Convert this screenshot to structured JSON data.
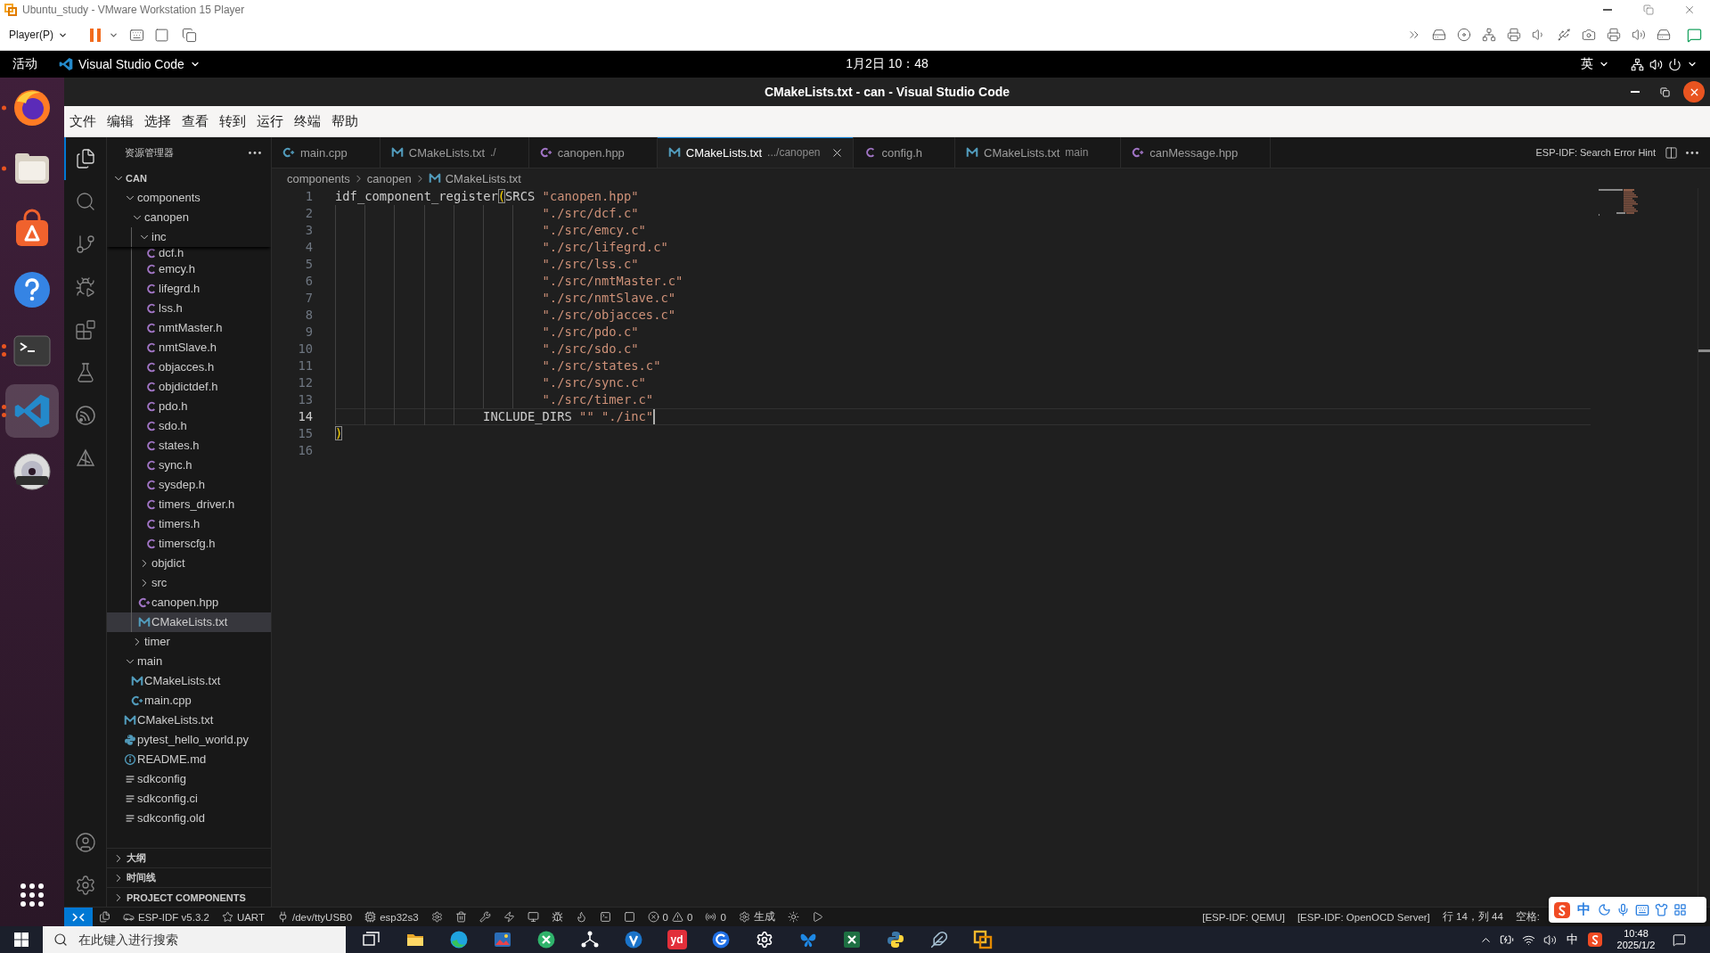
{
  "vm_window": {
    "title": "Ubuntu_study - VMware Workstation 15 Player",
    "player_menu": "Player(P)"
  },
  "top_bar": {
    "activities": "活动",
    "app_menu": "Visual Studio Code",
    "clock": "1月2日 10：48",
    "input_method": "英"
  },
  "dock": [
    {
      "kind": "browser",
      "running": true,
      "multiple_windows": false,
      "selected": false
    },
    {
      "kind": "files",
      "running": true,
      "multiple_windows": false,
      "selected": false
    },
    {
      "kind": "app-store",
      "running": false,
      "multiple_windows": false,
      "selected": false
    },
    {
      "kind": "help",
      "running": false,
      "multiple_windows": false,
      "selected": false
    },
    {
      "kind": "terminal",
      "running": true,
      "multiple_windows": true,
      "selected": false
    },
    {
      "kind": "code-editor",
      "running": true,
      "multiple_windows": true,
      "selected": true
    },
    {
      "kind": "dvd",
      "running": false,
      "multiple_windows": false,
      "selected": false
    }
  ],
  "vscode": {
    "title": "CMakeLists.txt - can - Visual Studio Code",
    "menu": [
      "文件",
      "编辑",
      "选择",
      "查看",
      "转到",
      "运行",
      "终端",
      "帮助"
    ],
    "activity_bar": [
      {
        "kind": "explorer",
        "selected": true
      },
      {
        "kind": "search",
        "selected": false
      },
      {
        "kind": "source-control",
        "selected": false
      },
      {
        "kind": "run-debug",
        "selected": false
      },
      {
        "kind": "extensions",
        "selected": false
      },
      {
        "kind": "testing",
        "selected": false
      },
      {
        "kind": "esp-idf",
        "selected": false
      },
      {
        "kind": "idf-tools",
        "selected": false
      }
    ],
    "explorer": {
      "title": "资源管理器",
      "workspace": {
        "name": "CAN",
        "expanded": true
      },
      "tree": [
        {
          "label": "components",
          "kind": "folder",
          "expanded": true,
          "selected": false,
          "children": [
            {
              "label": "canopen",
              "kind": "folder",
              "expanded": true,
              "selected": false,
              "children": [
                {
                  "label": "inc",
                  "kind": "folder",
                  "expanded": true,
                  "selected": false,
                  "children": [
                    {
                      "label": "dcf.h",
                      "kind": "c-header",
                      "selected": false
                    },
                    {
                      "label": "emcy.h",
                      "kind": "c-header",
                      "selected": false
                    },
                    {
                      "label": "lifegrd.h",
                      "kind": "c-header",
                      "selected": false
                    },
                    {
                      "label": "lss.h",
                      "kind": "c-header",
                      "selected": false
                    },
                    {
                      "label": "nmtMaster.h",
                      "kind": "c-header",
                      "selected": false
                    },
                    {
                      "label": "nmtSlave.h",
                      "kind": "c-header",
                      "selected": false
                    },
                    {
                      "label": "objacces.h",
                      "kind": "c-header",
                      "selected": false
                    },
                    {
                      "label": "objdictdef.h",
                      "kind": "c-header",
                      "selected": false
                    },
                    {
                      "label": "pdo.h",
                      "kind": "c-header",
                      "selected": false
                    },
                    {
                      "label": "sdo.h",
                      "kind": "c-header",
                      "selected": false
                    },
                    {
                      "label": "states.h",
                      "kind": "c-header",
                      "selected": false
                    },
                    {
                      "label": "sync.h",
                      "kind": "c-header",
                      "selected": false
                    },
                    {
                      "label": "sysdep.h",
                      "kind": "c-header",
                      "selected": false
                    },
                    {
                      "label": "timers_driver.h",
                      "kind": "c-header",
                      "selected": false
                    },
                    {
                      "label": "timers.h",
                      "kind": "c-header",
                      "selected": false
                    },
                    {
                      "label": "timerscfg.h",
                      "kind": "c-header",
                      "selected": false
                    }
                  ]
                },
                {
                  "label": "objdict",
                  "kind": "folder",
                  "expanded": false,
                  "selected": false
                },
                {
                  "label": "src",
                  "kind": "folder",
                  "expanded": false,
                  "selected": false
                },
                {
                  "label": "canopen.hpp",
                  "kind": "cpp-header",
                  "selected": false
                },
                {
                  "label": "CMakeLists.txt",
                  "kind": "cmake",
                  "selected": true
                }
              ]
            },
            {
              "label": "timer",
              "kind": "folder",
              "expanded": false,
              "selected": false
            }
          ]
        },
        {
          "label": "main",
          "kind": "folder",
          "expanded": true,
          "selected": false,
          "children": [
            {
              "label": "CMakeLists.txt",
              "kind": "cmake",
              "selected": false
            },
            {
              "label": "main.cpp",
              "kind": "cpp-source",
              "selected": false
            }
          ]
        },
        {
          "label": "CMakeLists.txt",
          "kind": "cmake",
          "selected": false
        },
        {
          "label": "pytest_hello_world.py",
          "kind": "python",
          "selected": false
        },
        {
          "label": "README.md",
          "kind": "info",
          "selected": false
        },
        {
          "label": "sdkconfig",
          "kind": "config",
          "selected": false
        },
        {
          "label": "sdkconfig.ci",
          "kind": "config",
          "selected": false
        },
        {
          "label": "sdkconfig.old",
          "kind": "config",
          "selected": false
        }
      ],
      "sections": [
        {
          "label": "大纲",
          "expanded": false
        },
        {
          "label": "时间线",
          "expanded": false
        },
        {
          "label": "PROJECT COMPONENTS",
          "expanded": false
        }
      ]
    },
    "tabs": [
      {
        "label": "main.cpp",
        "kind": "cpp-source",
        "selected": false
      },
      {
        "label": "CMakeLists.txt",
        "description": "./",
        "kind": "cmake",
        "selected": false
      },
      {
        "label": "canopen.hpp",
        "kind": "cpp-header",
        "selected": false
      },
      {
        "label": "CMakeLists.txt",
        "description": ".../canopen",
        "kind": "cmake",
        "selected": true
      },
      {
        "label": "config.h",
        "kind": "c-header",
        "selected": false
      },
      {
        "label": "CMakeLists.txt",
        "description": "main",
        "kind": "cmake",
        "selected": false
      },
      {
        "label": "canMessage.hpp",
        "kind": "cpp-header",
        "selected": false
      }
    ],
    "editor_actions": {
      "hint": "ESP-IDF: Search Error Hint"
    },
    "breadcrumb": {
      "path": [
        "components",
        "canopen"
      ],
      "file": {
        "label": "CMakeLists.txt",
        "kind": "cmake"
      }
    },
    "code": [
      {
        "number": "1",
        "current": false,
        "tokens": [
          {
            "kind": "plain",
            "text": "idf_component_register"
          },
          {
            "kind": "bracket",
            "text": "("
          },
          {
            "kind": "plain",
            "text": "SRCS "
          },
          {
            "kind": "string",
            "text": "\"canopen.hpp\""
          }
        ]
      },
      {
        "number": "2",
        "current": false,
        "tokens": [
          {
            "kind": "string",
            "text": "                            \"./src/dcf.c\""
          }
        ]
      },
      {
        "number": "3",
        "current": false,
        "tokens": [
          {
            "kind": "string",
            "text": "                            \"./src/emcy.c\""
          }
        ]
      },
      {
        "number": "4",
        "current": false,
        "tokens": [
          {
            "kind": "string",
            "text": "                            \"./src/lifegrd.c\""
          }
        ]
      },
      {
        "number": "5",
        "current": false,
        "tokens": [
          {
            "kind": "string",
            "text": "                            \"./src/lss.c\""
          }
        ]
      },
      {
        "number": "6",
        "current": false,
        "tokens": [
          {
            "kind": "string",
            "text": "                            \"./src/nmtMaster.c\""
          }
        ]
      },
      {
        "number": "7",
        "current": false,
        "tokens": [
          {
            "kind": "string",
            "text": "                            \"./src/nmtSlave.c\""
          }
        ]
      },
      {
        "number": "8",
        "current": false,
        "tokens": [
          {
            "kind": "string",
            "text": "                            \"./src/objacces.c\""
          }
        ]
      },
      {
        "number": "9",
        "current": false,
        "tokens": [
          {
            "kind": "string",
            "text": "                            \"./src/pdo.c\""
          }
        ]
      },
      {
        "number": "10",
        "current": false,
        "tokens": [
          {
            "kind": "string",
            "text": "                            \"./src/sdo.c\""
          }
        ]
      },
      {
        "number": "11",
        "current": false,
        "tokens": [
          {
            "kind": "string",
            "text": "                            \"./src/states.c\""
          }
        ]
      },
      {
        "number": "12",
        "current": false,
        "tokens": [
          {
            "kind": "string",
            "text": "                            \"./src/sync.c\""
          }
        ]
      },
      {
        "number": "13",
        "current": false,
        "tokens": [
          {
            "kind": "string",
            "text": "                            \"./src/timer.c\""
          }
        ]
      },
      {
        "number": "14",
        "current": true,
        "tokens": [
          {
            "kind": "plain",
            "text": "                    INCLUDE_DIRS "
          },
          {
            "kind": "string",
            "text": "\"\" \"./inc\""
          }
        ]
      },
      {
        "number": "15",
        "current": false,
        "tokens": [
          {
            "kind": "bracket",
            "text": ")"
          }
        ]
      },
      {
        "number": "16",
        "current": false
      }
    ],
    "status_bar": {
      "left": [
        {
          "kind": "remote"
        },
        {
          "kind": "files"
        },
        {
          "kind": "version",
          "text": "ESP-IDF v5.3.2"
        },
        {
          "kind": "star",
          "text": "UART"
        },
        {
          "kind": "plug",
          "text": "/dev/ttyUSB0"
        },
        {
          "kind": "chip",
          "text": "esp32s3"
        },
        {
          "kind": "gear"
        },
        {
          "kind": "trash"
        },
        {
          "kind": "wrench"
        },
        {
          "kind": "bolt"
        },
        {
          "kind": "monitor"
        },
        {
          "kind": "bug"
        },
        {
          "kind": "flame"
        },
        {
          "kind": "terminal"
        },
        {
          "kind": "square"
        },
        {
          "kind": "problems",
          "errors": "0",
          "warnings": "0"
        },
        {
          "kind": "broadcast",
          "text": "0"
        },
        {
          "kind": "gear",
          "text": "生成"
        },
        {
          "kind": "sun"
        },
        {
          "kind": "play"
        }
      ],
      "right": [
        {
          "kind": "text",
          "text": "[ESP-IDF: QEMU]"
        },
        {
          "kind": "text",
          "text": "[ESP-IDF: OpenOCD Server]"
        },
        {
          "kind": "text",
          "text": "行 14，列 44"
        },
        {
          "kind": "text",
          "text": "空格:"
        }
      ]
    }
  },
  "ime_bar": {
    "mode": "中"
  },
  "taskbar": {
    "search": {
      "placeholder": "在此键入进行搜索"
    },
    "apps": [
      {
        "kind": "task-view"
      },
      {
        "kind": "file-explorer"
      },
      {
        "kind": "browser"
      },
      {
        "kind": "image-viewer"
      },
      {
        "kind": "remote-shell"
      },
      {
        "kind": "network"
      },
      {
        "kind": "v-app"
      },
      {
        "kind": "text-tile",
        "label": "yd"
      },
      {
        "kind": "g-app"
      },
      {
        "kind": "settings"
      },
      {
        "kind": "butterfly"
      },
      {
        "kind": "spreadsheet"
      },
      {
        "kind": "python"
      },
      {
        "kind": "feather"
      },
      {
        "kind": "vm"
      }
    ],
    "tray": {
      "input_method": "中",
      "time": "10:48",
      "date": "2025/1/2"
    }
  }
}
